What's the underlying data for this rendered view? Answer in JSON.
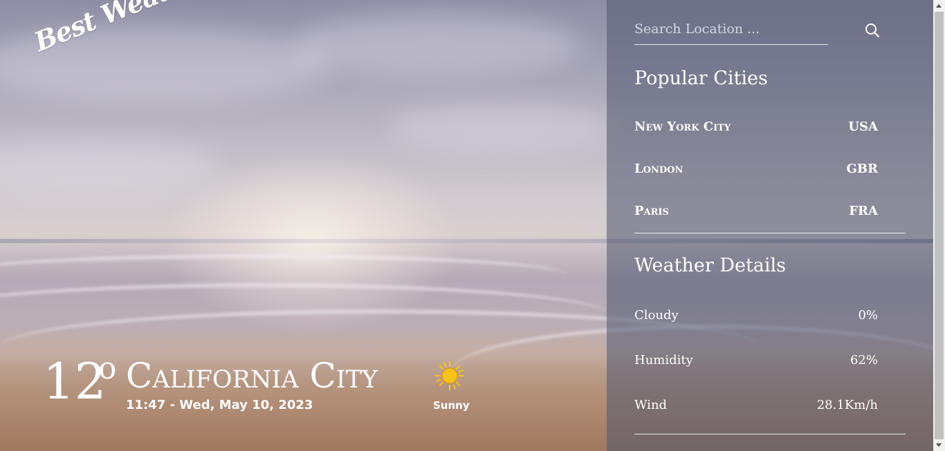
{
  "logo": {
    "text": "Best Weather App"
  },
  "current": {
    "temperature": "12",
    "degree_symbol": "o",
    "city": "California City",
    "datetime": "11:47 - Wed, May 10, 2023",
    "condition": "Sunny",
    "condition_icon": "sun-icon"
  },
  "search": {
    "placeholder": "Search Location ...",
    "value": "",
    "icon": "search-icon"
  },
  "popular": {
    "title": "Popular Cities",
    "cities": [
      {
        "name": "New York City",
        "country": "USA"
      },
      {
        "name": "London",
        "country": "GBR"
      },
      {
        "name": "Paris",
        "country": "FRA"
      }
    ]
  },
  "details": {
    "title": "Weather Details",
    "items": [
      {
        "label": "Cloudy",
        "value": "0%"
      },
      {
        "label": "Humidity",
        "value": "62%"
      },
      {
        "label": "Wind",
        "value": "28.1Km/h"
      }
    ]
  },
  "colors": {
    "panel_overlay": "#505870",
    "text": "#ffffff",
    "sun": "#f5c518"
  }
}
